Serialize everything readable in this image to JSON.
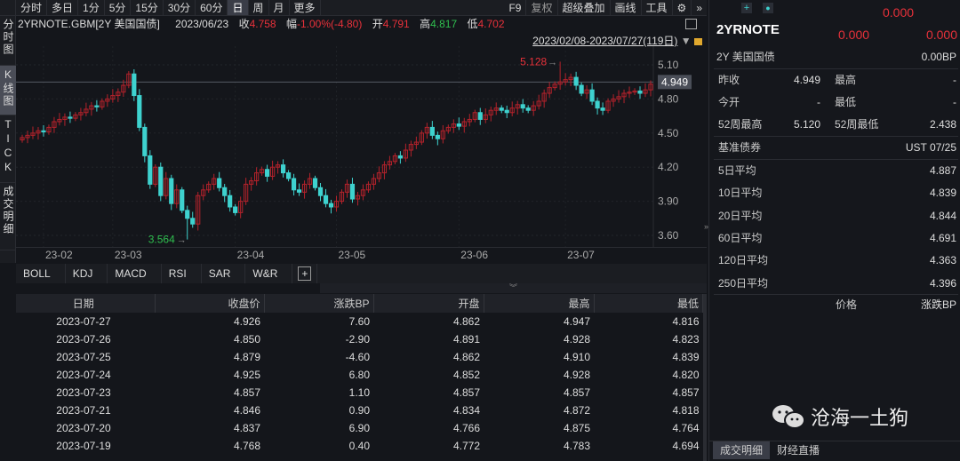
{
  "toolbar": {
    "tabs": [
      "分时",
      "多日",
      "1分",
      "5分",
      "15分",
      "30分",
      "60分",
      "日",
      "周",
      "月",
      "更多"
    ],
    "active": "日",
    "right": [
      "F9",
      "复权",
      "超级叠加",
      "画线",
      "工具"
    ]
  },
  "left_tabs": [
    "分时图",
    "K线图",
    "TICK",
    "成交明细"
  ],
  "info": {
    "symbol": "2YRNOTE.GBM[2Y 美国国债]",
    "date": "2023/06/23",
    "close_label": "收",
    "close": "4.758",
    "change_label": "幅",
    "change": "-1.00%(-4.80)",
    "open_label": "开",
    "open": "4.791",
    "high_label": "高",
    "high": "4.817",
    "low_label": "低",
    "low": "4.702"
  },
  "range_label": "2023/02/08-2023/07/27(119日)",
  "colors": {
    "up": "#b3222b",
    "down": "#3ed2cf",
    "bg": "#14161b"
  },
  "chart_data": {
    "type": "candlestick",
    "y_ticks": [
      "5.10",
      "4.80",
      "4.50",
      "4.20",
      "3.90",
      "3.60"
    ],
    "ylim": [
      3.5,
      5.25
    ],
    "x_ticks": [
      {
        "label": "23-02",
        "index": 4
      },
      {
        "label": "23-03",
        "index": 17
      },
      {
        "label": "23-04",
        "index": 40
      },
      {
        "label": "23-05",
        "index": 59
      },
      {
        "label": "23-06",
        "index": 82
      },
      {
        "label": "23-07",
        "index": 102
      }
    ],
    "current_price": "4.949",
    "max_label": "5.128",
    "max_value": 5.128,
    "max_index": 101,
    "min_label": "3.564",
    "min_value": 3.564,
    "min_index": 31,
    "closes": [
      4.46,
      4.48,
      4.5,
      4.52,
      4.51,
      4.55,
      4.6,
      4.62,
      4.64,
      4.63,
      4.66,
      4.68,
      4.71,
      4.74,
      4.73,
      4.78,
      4.8,
      4.83,
      4.86,
      4.92,
      5.02,
      4.83,
      4.55,
      4.3,
      4.05,
      4.2,
      3.95,
      4.1,
      3.88,
      4.0,
      3.82,
      3.75,
      3.7,
      3.95,
      4.0,
      4.05,
      4.1,
      4.02,
      3.95,
      3.85,
      3.8,
      3.9,
      4.05,
      4.08,
      4.15,
      4.18,
      4.12,
      4.2,
      4.22,
      4.15,
      4.1,
      4.0,
      3.98,
      4.05,
      4.1,
      4.02,
      3.95,
      3.88,
      3.85,
      3.9,
      3.98,
      4.05,
      3.92,
      3.95,
      4.0,
      4.05,
      4.1,
      4.15,
      4.22,
      4.25,
      4.3,
      4.28,
      4.35,
      4.4,
      4.42,
      4.5,
      4.55,
      4.48,
      4.45,
      4.52,
      4.55,
      4.58,
      4.56,
      4.6,
      4.62,
      4.68,
      4.62,
      4.66,
      4.7,
      4.72,
      4.7,
      4.68,
      4.72,
      4.75,
      4.72,
      4.7,
      4.74,
      4.78,
      4.85,
      4.9,
      4.93,
      4.95,
      4.97,
      4.99,
      4.92,
      4.85,
      4.88,
      4.78,
      4.72,
      4.7,
      4.78,
      4.8,
      4.82,
      4.85,
      4.86,
      4.87,
      4.85,
      4.88,
      4.93
    ]
  },
  "indicators": [
    "BOLL",
    "KDJ",
    "MACD",
    "RSI",
    "SAR",
    "W&R",
    "+"
  ],
  "table": {
    "headers": [
      "日期",
      "收盘价",
      "涨跌BP",
      "开盘",
      "最高",
      "最低"
    ],
    "rows": [
      [
        "2023-07-27",
        "4.926",
        "7.60",
        "4.862",
        "4.947",
        "4.816"
      ],
      [
        "2023-07-26",
        "4.850",
        "-2.90",
        "4.891",
        "4.928",
        "4.823"
      ],
      [
        "2023-07-25",
        "4.879",
        "-4.60",
        "4.862",
        "4.910",
        "4.839"
      ],
      [
        "2023-07-24",
        "4.925",
        "6.80",
        "4.852",
        "4.928",
        "4.820"
      ],
      [
        "2023-07-23",
        "4.857",
        "1.10",
        "4.857",
        "4.857",
        "4.857"
      ],
      [
        "2023-07-21",
        "4.846",
        "0.90",
        "4.834",
        "4.872",
        "4.818"
      ],
      [
        "2023-07-20",
        "4.837",
        "6.90",
        "4.766",
        "4.875",
        "4.764"
      ],
      [
        "2023-07-19",
        "4.768",
        "0.40",
        "4.772",
        "4.783",
        "4.694"
      ]
    ]
  },
  "quote": {
    "top_value": "0.000",
    "name": "2YRNOTE",
    "bid": "0.000",
    "ask": "0.000",
    "desc": "2Y 美国国债",
    "change_bp": "0.00BP",
    "grid": [
      {
        "l1": "昨收",
        "v1": "4.949",
        "l2": "最高",
        "v2": "-"
      },
      {
        "l1": "今开",
        "v1": "-",
        "l2": "最低",
        "v2": "-"
      },
      {
        "l1": "52周最高",
        "v1": "5.120",
        "l2": "52周最低",
        "v2": "2.438"
      }
    ],
    "benchmark_label": "基准债券",
    "benchmark": "UST 07/25",
    "averages": [
      {
        "label": "5日平均",
        "value": "4.887"
      },
      {
        "label": "10日平均",
        "value": "4.839"
      },
      {
        "label": "20日平均",
        "value": "4.844"
      },
      {
        "label": "60日平均",
        "value": "4.691"
      },
      {
        "label": "120日平均",
        "value": "4.363"
      },
      {
        "label": "250日平均",
        "value": "4.396"
      }
    ],
    "col_price": "价格",
    "col_change": "涨跌BP"
  },
  "watermark": "沧海一土狗",
  "right_tabs": [
    "成交明细",
    "财经直播"
  ]
}
